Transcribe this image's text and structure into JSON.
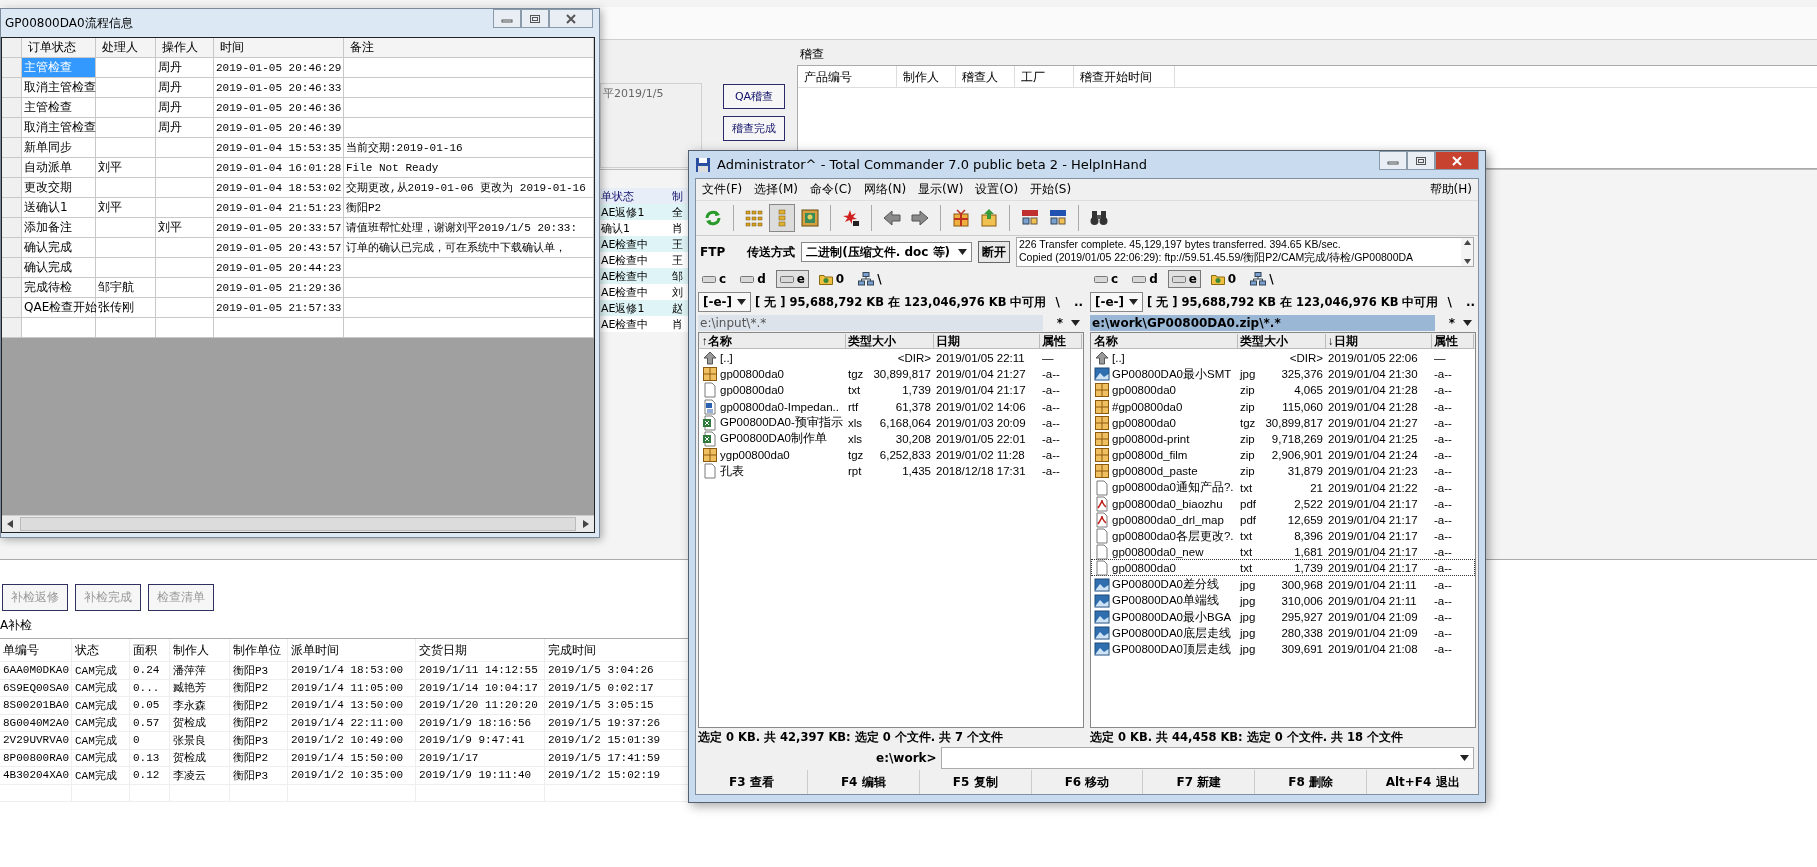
{
  "background_app": {
    "note": "平2019/1/5",
    "audit_buttons": [
      {
        "label": "QA稽查"
      },
      {
        "label": "稽查完成"
      }
    ],
    "audit_group": {
      "title": "稽查",
      "columns": [
        "产品编号",
        "制作人",
        "稽查人",
        "工厂",
        "稽查开始时间"
      ]
    },
    "order_table": {
      "columns": [
        "单状态",
        "制"
      ],
      "rows": [
        [
          "AE返修1",
          "全"
        ],
        [
          "确认1",
          "肖"
        ],
        [
          "AE检查中",
          "王"
        ],
        [
          "AE检查中",
          "王"
        ],
        [
          "AE检查中",
          "邹"
        ],
        [
          "AE检查中",
          "刘"
        ],
        [
          "AE返修1",
          "赵"
        ],
        [
          "AE检查中",
          "肖"
        ]
      ]
    },
    "recheck_buttons": [
      {
        "label": "补检返修"
      },
      {
        "label": "补检完成"
      },
      {
        "label": "检查清单"
      }
    ],
    "recheck_label": "A补检",
    "recheck_table": {
      "columns": [
        "单编号",
        "状态",
        "面积",
        "制作人",
        "制作单位",
        "派单时间",
        "交货日期",
        "完成时间"
      ],
      "rows": [
        [
          "6AA0M0DKA0",
          "CAM完成",
          "0.24",
          "潘萍萍",
          "衡阳P3",
          "2019/1/4 18:53:00",
          "2019/1/11 14:12:55",
          "2019/1/5 3:04:26"
        ],
        [
          "6S9EQ00SA0",
          "CAM完成",
          "0...",
          "臧艳芳",
          "衡阳P2",
          "2019/1/4 11:05:00",
          "2019/1/14 10:04:17",
          "2019/1/5 0:02:17"
        ],
        [
          "8S00201BA0",
          "CAM完成",
          "0.05",
          "李永森",
          "衡阳P2",
          "2019/1/4 13:50:00",
          "2019/1/20 11:20:20",
          "2019/1/5 3:05:15"
        ],
        [
          "8G0040M2A0",
          "CAM完成",
          "0.57",
          "贺检成",
          "衡阳P2",
          "2019/1/4 22:11:00",
          "2019/1/9 18:16:56",
          "2019/1/5 19:37:26"
        ],
        [
          "2V29UVRVA0",
          "CAM完成",
          "0",
          "张景良",
          "衡阳P3",
          "2019/1/2 10:49:00",
          "2019/1/9 9:47:41",
          "2019/1/2 15:01:39"
        ],
        [
          "8P00800RA0",
          "CAM完成",
          "0.13",
          "贺检成",
          "衡阳P2",
          "2019/1/4 15:50:00",
          "2019/1/17",
          "2019/1/5 17:41:59"
        ],
        [
          "4B30204XA0",
          "CAM完成",
          "0.12",
          "李凌云",
          "衡阳P3",
          "2019/1/2 10:35:00",
          "2019/1/9 19:11:40",
          "2019/1/2 15:02:19"
        ]
      ]
    }
  },
  "flow_window": {
    "title": "GP00800DA0流程信息",
    "columns": [
      "订单状态",
      "处理人",
      "操作人",
      "时间",
      "备注"
    ],
    "rows": [
      {
        "cells": [
          "主管检查",
          "",
          "周丹",
          "2019-01-05 20:46:29",
          ""
        ],
        "selected": true
      },
      {
        "cells": [
          "取消主管检查",
          "",
          "周丹",
          "2019-01-05 20:46:33",
          ""
        ],
        "selected": false
      },
      {
        "cells": [
          "主管检查",
          "",
          "周丹",
          "2019-01-05 20:46:36",
          ""
        ],
        "selected": false
      },
      {
        "cells": [
          "取消主管检查",
          "",
          "周丹",
          "2019-01-05 20:46:39",
          ""
        ],
        "selected": false
      },
      {
        "cells": [
          "新单同步",
          "",
          "",
          "2019-01-04 15:53:35",
          "当前交期:2019-01-16"
        ],
        "selected": false
      },
      {
        "cells": [
          "自动派单",
          "刘平",
          "",
          "2019-01-04 16:01:28",
          "File Not Ready"
        ],
        "selected": false
      },
      {
        "cells": [
          "更改交期",
          "",
          "",
          "2019-01-04 18:53:02",
          "交期更改,从2019-01-06 更改为 2019-01-16"
        ],
        "selected": false
      },
      {
        "cells": [
          "送确认1",
          "刘平",
          "",
          "2019-01-04 21:51:23",
          "衡阳P2"
        ],
        "selected": false
      },
      {
        "cells": [
          "添加备注",
          "",
          "刘平",
          "2019-01-05 20:33:57",
          "请值班帮忙处理，谢谢刘平2019/1/5 20:33:"
        ],
        "selected": false
      },
      {
        "cells": [
          "确认完成",
          "",
          "",
          "2019-01-05 20:43:57",
          "订单的确认已完成，可在系统中下载确认单，"
        ],
        "selected": false
      },
      {
        "cells": [
          "确认完成",
          "",
          "",
          "2019-01-05 20:44:23",
          ""
        ],
        "selected": false
      },
      {
        "cells": [
          "完成待检",
          "邹宇航",
          "",
          "2019-01-05 21:29:36",
          ""
        ],
        "selected": false
      },
      {
        "cells": [
          "QAE检查开始",
          "张传刚",
          "",
          "2019-01-05 21:57:33",
          ""
        ],
        "selected": false
      }
    ]
  },
  "total_commander": {
    "title": "Administrator^ - Total Commander 7.0 public beta 2 - HelpInHand",
    "menu": [
      "文件(F)",
      "选择(M)",
      "命令(C)",
      "网络(N)",
      "显示(W)",
      "设置(O)",
      "开始(S)"
    ],
    "help_menu": "帮助(H)",
    "toolbar": [
      {
        "pressed": false
      },
      {
        "pressed": false
      },
      {
        "pressed": true
      },
      {
        "pressed": false
      },
      {
        "pressed": false
      },
      {
        "pressed": false
      },
      {
        "pressed": false
      },
      {
        "pressed": false
      },
      {
        "pressed": false
      },
      {
        "pressed": false
      },
      {
        "pressed": false
      },
      {
        "pressed": false
      }
    ],
    "ftp": {
      "label": "FTP",
      "mode_label": "传送方式",
      "mode": "二进制(压缩文件. doc 等)",
      "disconnect": "断开",
      "log": [
        "226 Transfer complete. 45,129,197 bytes transferred. 394.65 KB/sec.",
        "Copied (2019/01/05 22:06:29): ftp://59.51.45.59/衡阳P2/CAM完成/待检/GP00800DA"
      ]
    },
    "panels": [
      {
        "drives": [
          {
            "label": "c",
            "selected": false
          },
          {
            "label": "d",
            "selected": false
          },
          {
            "label": "e",
            "selected": true
          }
        ],
        "net_drive": "0",
        "root_button": "\\",
        "drive_combo": "[-e-]",
        "free_space": "[ 无 ]  95,688,792 KB 在 123,046,976 KB 中可用",
        "root": "\\",
        "parent": "..",
        "path": "e:\\input\\*.*",
        "active": false,
        "filter": "*",
        "columns": [
          "↑名称",
          "类型",
          "大小",
          "日期",
          "属性"
        ],
        "files": [
          {
            "kind": "up",
            "name": "[..]",
            "size": "<DIR>",
            "date": "2019/01/05 22:11",
            "attr": "—",
            "focused": false
          },
          {
            "kind": "archive",
            "name": "gp00800da0",
            "ext": "tgz",
            "size": "30,899,817",
            "date": "2019/01/04 21:27",
            "attr": "-a--",
            "focused": false
          },
          {
            "kind": "text",
            "name": "gp00800da0",
            "ext": "txt",
            "size": "1,739",
            "date": "2019/01/04 21:17",
            "attr": "-a--",
            "focused": false
          },
          {
            "kind": "document",
            "name": "gp00800da0-Impedan..",
            "ext": "rtf",
            "size": "61,378",
            "date": "2019/01/02 14:06",
            "attr": "-a--",
            "focused": false
          },
          {
            "kind": "spreadsheet",
            "name": "GP00800DA0-预审指示",
            "ext": "xls",
            "size": "6,168,064",
            "date": "2019/01/03 20:09",
            "attr": "-a--",
            "focused": false
          },
          {
            "kind": "spreadsheet",
            "name": "GP00800DA0制作单",
            "ext": "xls",
            "size": "30,208",
            "date": "2019/01/05 22:01",
            "attr": "-a--",
            "focused": false
          },
          {
            "kind": "archive",
            "name": "ygp00800da0",
            "ext": "tgz",
            "size": "6,252,833",
            "date": "2019/01/02 11:28",
            "attr": "-a--",
            "focused": false
          },
          {
            "kind": "text",
            "name": "孔表",
            "ext": "rpt",
            "size": "1,435",
            "date": "2018/12/18 17:31",
            "attr": "-a--",
            "focused": false
          }
        ],
        "status": "选定 0 KB. 共 42,397 KB: 选定 0 个文件. 共 7 个文件"
      },
      {
        "drives": [
          {
            "label": "c",
            "selected": false
          },
          {
            "label": "d",
            "selected": false
          },
          {
            "label": "e",
            "selected": true
          }
        ],
        "net_drive": "0",
        "root_button": "\\",
        "drive_combo": "[-e-]",
        "free_space": "[ 无 ]  95,688,792 KB 在 123,046,976 KB 中可用",
        "root": "\\",
        "parent": "..",
        "path": "e:\\work\\GP00800DA0.zip\\*.*",
        "active": true,
        "filter": "*",
        "columns": [
          "名称",
          "类型",
          "大小",
          "↓日期",
          "属性"
        ],
        "files": [
          {
            "kind": "up",
            "name": "[..]",
            "size": "<DIR>",
            "date": "2019/01/05 22:06",
            "attr": "—",
            "focused": false
          },
          {
            "kind": "image",
            "name": "GP00800DA0最小SMT",
            "ext": "jpg",
            "size": "325,376",
            "date": "2019/01/04 21:30",
            "attr": "-a--",
            "focused": false
          },
          {
            "kind": "archive",
            "name": "gp00800da0",
            "ext": "zip",
            "size": "4,065",
            "date": "2019/01/04 21:28",
            "attr": "-a--",
            "focused": false
          },
          {
            "kind": "archive",
            "name": "#gp00800da0",
            "ext": "zip",
            "size": "115,060",
            "date": "2019/01/04 21:28",
            "attr": "-a--",
            "focused": false
          },
          {
            "kind": "archive",
            "name": "gp00800da0",
            "ext": "tgz",
            "size": "30,899,817",
            "date": "2019/01/04 21:27",
            "attr": "-a--",
            "focused": false
          },
          {
            "kind": "archive",
            "name": "gp00800d-print",
            "ext": "zip",
            "size": "9,718,269",
            "date": "2019/01/04 21:25",
            "attr": "-a--",
            "focused": false
          },
          {
            "kind": "archive",
            "name": "gp00800d_film",
            "ext": "zip",
            "size": "2,906,901",
            "date": "2019/01/04 21:24",
            "attr": "-a--",
            "focused": false
          },
          {
            "kind": "archive",
            "name": "gp00800d_paste",
            "ext": "zip",
            "size": "31,879",
            "date": "2019/01/04 21:23",
            "attr": "-a--",
            "focused": false
          },
          {
            "kind": "text",
            "name": "gp00800da0通知产品?.",
            "ext": "txt",
            "size": "21",
            "date": "2019/01/04 21:22",
            "attr": "-a--",
            "focused": false
          },
          {
            "kind": "pdf",
            "name": "gp00800da0_biaozhu",
            "ext": "pdf",
            "size": "2,522",
            "date": "2019/01/04 21:17",
            "attr": "-a--",
            "focused": false
          },
          {
            "kind": "pdf",
            "name": "gp00800da0_drl_map",
            "ext": "pdf",
            "size": "12,659",
            "date": "2019/01/04 21:17",
            "attr": "-a--",
            "focused": false
          },
          {
            "kind": "text",
            "name": "gp00800da0各层更改?.",
            "ext": "txt",
            "size": "8,396",
            "date": "2019/01/04 21:17",
            "attr": "-a--",
            "focused": false
          },
          {
            "kind": "text",
            "name": "gp00800da0_new",
            "ext": "txt",
            "size": "1,681",
            "date": "2019/01/04 21:17",
            "attr": "-a--",
            "focused": false
          },
          {
            "kind": "text",
            "name": "gp00800da0",
            "ext": "txt",
            "size": "1,739",
            "date": "2019/01/04 21:17",
            "attr": "-a--",
            "focused": true
          },
          {
            "kind": "image",
            "name": "GP00800DA0差分线",
            "ext": "jpg",
            "size": "300,968",
            "date": "2019/01/04 21:11",
            "attr": "-a--",
            "focused": false
          },
          {
            "kind": "image",
            "name": "GP00800DA0单端线",
            "ext": "jpg",
            "size": "310,006",
            "date": "2019/01/04 21:11",
            "attr": "-a--",
            "focused": false
          },
          {
            "kind": "image",
            "name": "GP00800DA0最小BGA",
            "ext": "jpg",
            "size": "295,927",
            "date": "2019/01/04 21:09",
            "attr": "-a--",
            "focused": false
          },
          {
            "kind": "image",
            "name": "GP00800DA0底层走线",
            "ext": "jpg",
            "size": "280,338",
            "date": "2019/01/04 21:09",
            "attr": "-a--",
            "focused": false
          },
          {
            "kind": "image",
            "name": "GP00800DA0顶层走线",
            "ext": "jpg",
            "size": "309,691",
            "date": "2019/01/04 21:08",
            "attr": "-a--",
            "focused": false
          }
        ],
        "status": "选定 0 KB. 共 44,458 KB: 选定 0 个文件. 共 18 个文件"
      }
    ],
    "command_prompt": "e:\\work>",
    "function_keys": [
      "F3 查看",
      "F4 编辑",
      "F5 复制",
      "F6 移动",
      "F7 新建",
      "F8 删除",
      "Alt+F4 退出"
    ]
  }
}
